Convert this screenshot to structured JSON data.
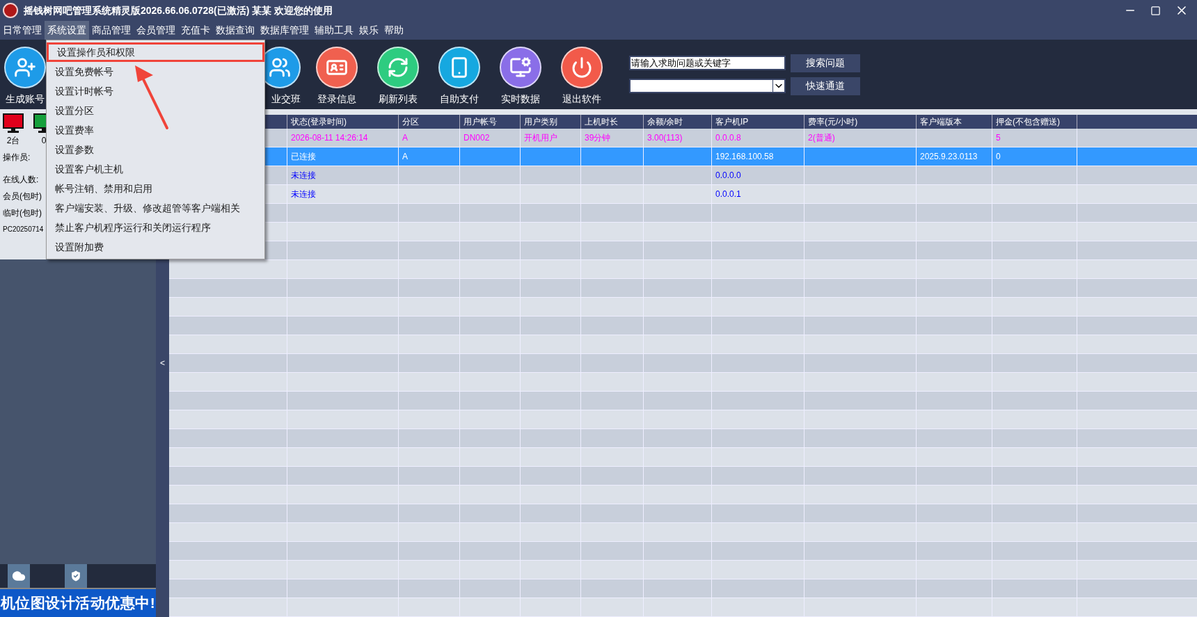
{
  "window": {
    "title": "摇钱树网吧管理系统精灵版2026.66.06.0728(已激活)  某某 欢迎您的使用"
  },
  "menu_bar": [
    {
      "label": "日常管理",
      "selected": false
    },
    {
      "label": "系统设置",
      "selected": true
    },
    {
      "label": "商品管理",
      "selected": false
    },
    {
      "label": "会员管理",
      "selected": false
    },
    {
      "label": "充值卡",
      "selected": false
    },
    {
      "label": "数据查询",
      "selected": false
    },
    {
      "label": "数据库管理",
      "selected": false
    },
    {
      "label": "辅助工具",
      "selected": false
    },
    {
      "label": "娱乐",
      "selected": false
    },
    {
      "label": "帮助",
      "selected": false
    }
  ],
  "dropdown_menu": [
    {
      "label": "设置操作员和权限",
      "highlighted": true
    },
    {
      "label": "设置免费帐号",
      "highlighted": false
    },
    {
      "label": "设置计时帐号",
      "highlighted": false
    },
    {
      "label": "设置分区",
      "highlighted": false
    },
    {
      "label": "设置费率",
      "highlighted": false
    },
    {
      "label": "设置参数",
      "highlighted": false
    },
    {
      "label": "设置客户机主机",
      "highlighted": false
    },
    {
      "label": "帐号注销、禁用和启用",
      "highlighted": false
    },
    {
      "label": "客户端安装、升级、修改超管等客户端相关",
      "highlighted": false
    },
    {
      "label": "禁止客户机程序运行和关闭运行程序",
      "highlighted": false
    },
    {
      "label": "设置附加费",
      "highlighted": false
    }
  ],
  "toolbar": {
    "first": {
      "label": "生成账号",
      "kind": "add_user"
    },
    "items": [
      {
        "label": "业交班",
        "kind": "handover"
      },
      {
        "label": "登录信息",
        "kind": "login"
      },
      {
        "label": "刷新列表",
        "kind": "refresh"
      },
      {
        "label": "自助支付",
        "kind": "pay"
      },
      {
        "label": "实时数据",
        "kind": "realtime"
      },
      {
        "label": "退出软件",
        "kind": "exit"
      }
    ]
  },
  "help": {
    "search_value": "请输入求助问题或关键字",
    "search_button": "搜索问题",
    "channel_button": "快速通道"
  },
  "left_panel": {
    "machines": [
      {
        "count": "2台",
        "kind": "offline"
      },
      {
        "count": "0",
        "kind": "online"
      }
    ],
    "lines": [
      "操作员:",
      "在线人数:",
      "会员(包时)",
      "临时(包时)",
      "PC20250714"
    ],
    "banner": "机位图设计活动优惠中!",
    "collapse_label": "<"
  },
  "table": {
    "columns": [
      "状态(登录时间)",
      "分区",
      "用户帐号",
      "用户类别",
      "上机时长",
      "余额/余时",
      "客户机IP",
      "费率(元/小时)",
      "客户端版本",
      "押金(不包含赠送)"
    ],
    "rows": [
      {
        "kind": "in_use",
        "selected": false,
        "cells": [
          "2026-08-11 14:26:14",
          "A",
          "DN002",
          "开机用户",
          "39分钟",
          "3.00(113)",
          "0.0.0.8",
          "2(普通)",
          null,
          "5"
        ]
      },
      {
        "kind": "connected",
        "selected": true,
        "cells": [
          "已连接",
          "A",
          null,
          null,
          null,
          null,
          "192.168.100.58",
          null,
          "2025.9.23.0113",
          "0"
        ]
      },
      {
        "kind": "disconnected",
        "selected": false,
        "cells": [
          "未连接",
          null,
          null,
          null,
          null,
          null,
          "0.0.0.0",
          null,
          null,
          null
        ]
      },
      {
        "kind": "disconnected",
        "selected": false,
        "cells": [
          "未连接",
          null,
          null,
          null,
          null,
          null,
          "0.0.0.1",
          null,
          null,
          null
        ]
      }
    ]
  }
}
